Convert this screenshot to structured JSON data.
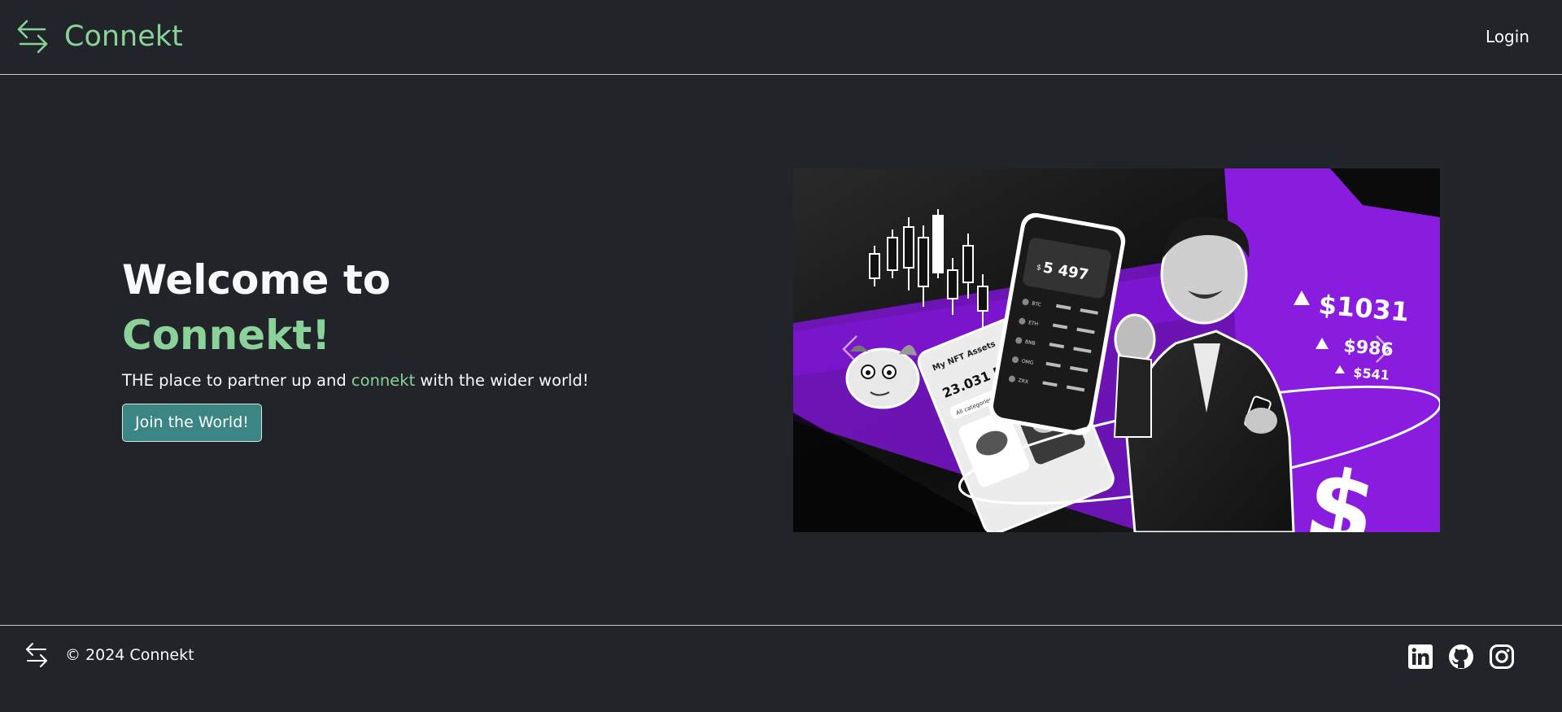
{
  "header": {
    "brand": "Connekt",
    "login_label": "Login"
  },
  "hero": {
    "title_line1": "Welcome to",
    "title_line2": "Connekt!",
    "tagline_before": "THE place to partner up and ",
    "tagline_highlight": "connekt",
    "tagline_after": " with the wider world!",
    "cta_label": "Join the World!"
  },
  "carousel": {
    "phone_balance": "5 497",
    "phone_currency": "$",
    "nft_title": "My NFT Assets",
    "nft_balance": "23.031 ETH",
    "nft_filter": "All categories",
    "price_1": "$1031",
    "price_2": "$986",
    "price_3": "$541",
    "dollar_sign": "$",
    "coins": [
      "BTC",
      "ETH",
      "BNB",
      "OMG",
      "ZRX"
    ],
    "icons": {
      "prev": "chevron-left-icon",
      "next": "chevron-right-icon"
    }
  },
  "footer": {
    "copyright": "© 2024 Connekt",
    "socials": [
      "linkedin-icon",
      "github-icon",
      "instagram-icon"
    ]
  },
  "colors": {
    "background": "#212529",
    "accent": "#8ad19a",
    "button": "#3b8584",
    "purple": "#8a1ce0"
  }
}
